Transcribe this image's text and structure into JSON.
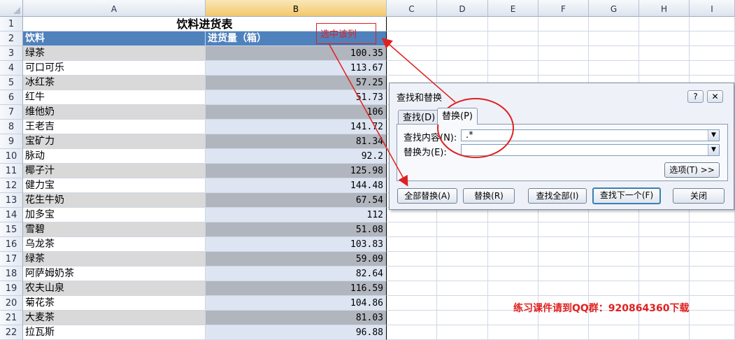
{
  "columns": [
    "A",
    "B",
    "C",
    "D",
    "E",
    "F",
    "G",
    "H",
    "I"
  ],
  "rows": [
    "1",
    "2",
    "3",
    "4",
    "5",
    "6",
    "7",
    "8",
    "9",
    "10",
    "11",
    "12",
    "13",
    "14",
    "15",
    "16",
    "17",
    "18",
    "19",
    "20",
    "21",
    "22"
  ],
  "sheet": {
    "title": "饮料进货表",
    "header_a": "饮料",
    "header_b": "进货量（箱）",
    "data": [
      {
        "name": "绿茶",
        "qty": "100.35"
      },
      {
        "name": "可口可乐",
        "qty": "113.67"
      },
      {
        "name": "冰红茶",
        "qty": "57.25"
      },
      {
        "name": "红牛",
        "qty": "51.73"
      },
      {
        "name": "维他奶",
        "qty": "106"
      },
      {
        "name": "王老吉",
        "qty": "141.72"
      },
      {
        "name": "宝矿力",
        "qty": "81.34"
      },
      {
        "name": "脉动",
        "qty": "92.2"
      },
      {
        "name": "椰子汁",
        "qty": "125.98"
      },
      {
        "name": "健力宝",
        "qty": "144.48"
      },
      {
        "name": "花生牛奶",
        "qty": "67.54"
      },
      {
        "name": "加多宝",
        "qty": "112"
      },
      {
        "name": "雪碧",
        "qty": "51.08"
      },
      {
        "name": "乌龙茶",
        "qty": "103.83"
      },
      {
        "name": "绿茶",
        "qty": "59.09"
      },
      {
        "name": "阿萨姆奶茶",
        "qty": "82.64"
      },
      {
        "name": "农夫山泉",
        "qty": "116.59"
      },
      {
        "name": "菊花茶",
        "qty": "104.86"
      },
      {
        "name": "大麦茶",
        "qty": "81.03"
      },
      {
        "name": "拉瓦斯",
        "qty": "96.88"
      }
    ]
  },
  "annotations": {
    "select_column": "选中该列",
    "footer_note": "练习课件请到QQ群：920864360下载",
    "color": "#e02020"
  },
  "dialog": {
    "title": "查找和替换",
    "help": "?",
    "close_x": "✕",
    "tab_find": "查找(D)",
    "tab_replace": "替换(P)",
    "find_label": "查找内容(N):",
    "find_value": ".*",
    "replace_label": "替换为(E):",
    "replace_value": "",
    "options_button": "选项(T) >>",
    "replace_all": "全部替换(A)",
    "replace": "替换(R)",
    "find_all": "查找全部(I)",
    "find_next": "查找下一个(F)",
    "close": "关闭"
  }
}
